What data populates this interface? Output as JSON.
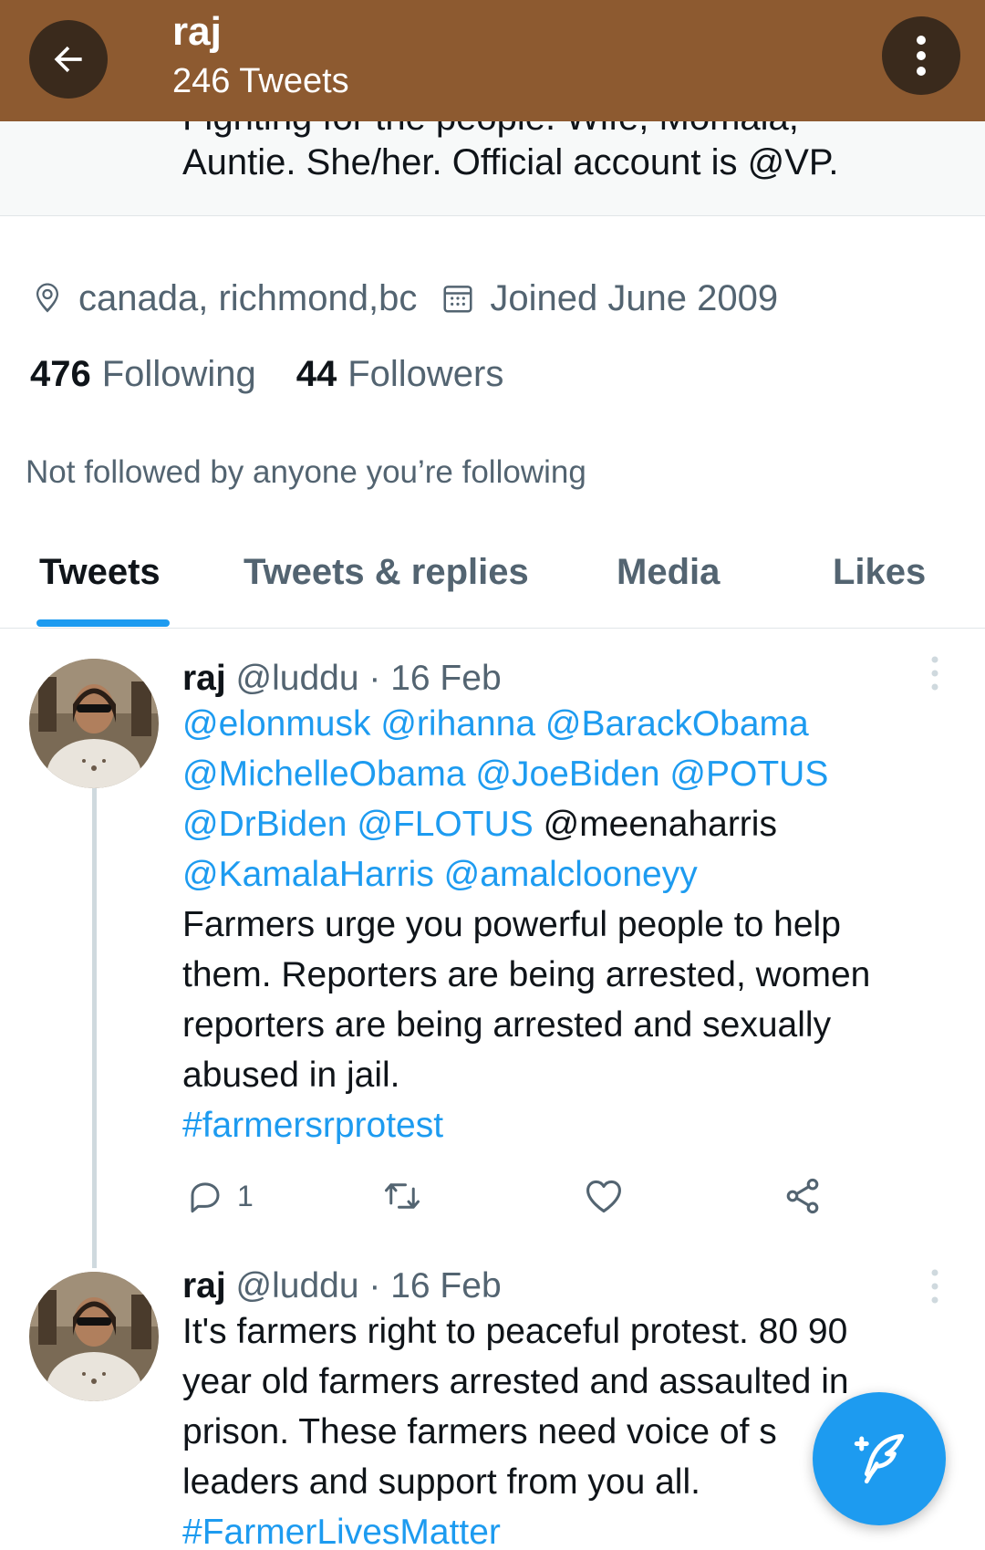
{
  "header": {
    "name": "raj",
    "tweet_count": "246 Tweets"
  },
  "bio": {
    "cut_line": "Fighting for the people. Wife, Momala,",
    "last_line": "Auntie. She/her. Official account is @VP."
  },
  "profile": {
    "location": "canada, richmond,bc",
    "joined": "Joined June 2009",
    "following_count": "476",
    "following_label": "Following",
    "followers_count": "44",
    "followers_label": "Followers",
    "not_followed": "Not followed by anyone you’re following"
  },
  "tabs": [
    {
      "label": "Tweets",
      "active": true
    },
    {
      "label": "Tweets & replies",
      "active": false
    },
    {
      "label": "Media",
      "active": false
    },
    {
      "label": "Likes",
      "active": false
    }
  ],
  "tweets": [
    {
      "name": "raj",
      "meta": "@luddu · 16 Feb",
      "lines": [
        [
          {
            "t": "@elonmusk @rihanna @BarackObama",
            "m": true
          }
        ],
        [
          {
            "t": "@MichelleObama @JoeBiden @POTUS",
            "m": true
          }
        ],
        [
          {
            "t": "@DrBiden @FLOTUS",
            "m": true
          },
          {
            "t": " @meenaharris",
            "m": false
          }
        ],
        [
          {
            "t": "@KamalaHarris @amalclooneyy",
            "m": true
          }
        ],
        [
          {
            "t": "Farmers urge you powerful people to help",
            "m": false
          }
        ],
        [
          {
            "t": "them. Reporters are being arrested, women",
            "m": false
          }
        ],
        [
          {
            "t": "reporters are being arrested and sexually",
            "m": false
          }
        ],
        [
          {
            "t": "abused in jail.",
            "m": false
          }
        ],
        [
          {
            "t": "#farmersrprotest",
            "m": true
          }
        ]
      ],
      "reply_count": "1"
    },
    {
      "name": "raj",
      "meta": "@luddu · 16 Feb",
      "lines": [
        [
          {
            "t": "It's farmers right to peaceful protest. 80 90",
            "m": false
          }
        ],
        [
          {
            "t": "year old farmers arrested and assaulted in",
            "m": false
          }
        ],
        [
          {
            "t": "prison. These farmers need voice of s",
            "m": false
          }
        ],
        [
          {
            "t": "leaders and support from you all.",
            "m": false
          }
        ],
        [
          {
            "t": "#FarmerLivesMatter",
            "m": true
          }
        ]
      ]
    }
  ],
  "colors": {
    "header_bg": "#8d5a30",
    "accent": "#1d9bf0",
    "secondary_text": "#536471"
  },
  "icons": {
    "back": "arrow-left-icon",
    "more": "vertical-dots-icon",
    "location": "location-pin-icon",
    "calendar": "calendar-icon",
    "reply": "reply-icon",
    "retweet": "retweet-icon",
    "like": "heart-icon",
    "share": "share-icon",
    "compose": "compose-feather-icon"
  }
}
